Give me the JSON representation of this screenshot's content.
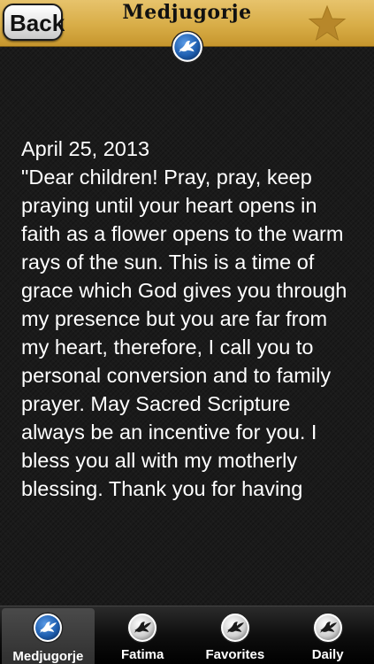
{
  "header": {
    "back_label": "Back",
    "title": "Medjugorje",
    "emblem_icon": "dove-icon",
    "favorite_icon": "star-icon"
  },
  "message": {
    "date": "April 25, 2013",
    "text": "\"Dear children! Pray, pray, keep praying until your heart opens in faith as a flower opens to the warm rays of the sun. This is a time of grace which God gives you through my presence but you are far from my heart, therefore, I call you to personal conversion and to family prayer. May Sacred Scripture always be an incentive for you. I bless you all with my motherly blessing. Thank you for having"
  },
  "tabs": [
    {
      "label": "Medjugorje",
      "icon": "dove-icon",
      "active": true
    },
    {
      "label": "Fatima",
      "icon": "dove-icon",
      "active": false
    },
    {
      "label": "Favorites",
      "icon": "dove-icon",
      "active": false
    },
    {
      "label": "Daily",
      "icon": "dove-icon",
      "active": false
    }
  ],
  "colors": {
    "header_gold": "#d8ad47",
    "emblem_blue": "#1f5fb0",
    "text": "#ffffff",
    "background": "#1a1a1a"
  }
}
